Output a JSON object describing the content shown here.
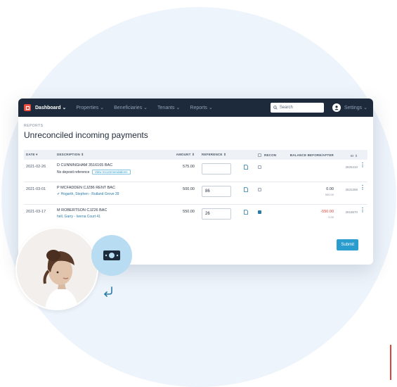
{
  "nav": {
    "items": [
      {
        "label": "Dashboard",
        "active": true
      },
      {
        "label": "Properties",
        "active": false
      },
      {
        "label": "Beneficiaries",
        "active": false
      },
      {
        "label": "Tenants",
        "active": false
      },
      {
        "label": "Reports",
        "active": false
      }
    ],
    "search_placeholder": "Search",
    "settings_label": "Settings",
    "dropdown_glyph": "⌄"
  },
  "page": {
    "breadcrumb": "REPORTS",
    "title": "Unreconciled incoming payments",
    "submit_label": "Submit"
  },
  "table": {
    "headers": {
      "date": "DATE",
      "description": "DESCRIPTION",
      "amount": "AMOUNT",
      "reference": "REFERENCE",
      "recon": "RECON",
      "balance": "BALANCE BEFORE/AFTER",
      "id": "ID"
    },
    "rows": [
      {
        "date": "2021-02-26",
        "description": "D CUNNINGHAM 3516165 BAC",
        "detail": "No deposit reference",
        "action": "View recommendations",
        "matched": "",
        "amount": "575.00",
        "reference": "",
        "recon_checked": false,
        "balance": "",
        "balance_after": "",
        "id": "2625410"
      },
      {
        "date": "2021-03-01",
        "description": "P MCFADDEN CJZ86 RENT BAC",
        "detail": "",
        "action": "",
        "matched": "Hogarth, Stephen - Rutland Grove 39",
        "amount": "500.00",
        "reference": "86",
        "recon_checked": false,
        "balance": "0.00",
        "balance_after": "500.00",
        "id": "2631269"
      },
      {
        "date": "2021-03-17",
        "description": "M ROBERTSON CJZ26 BAC",
        "detail": "",
        "action": "",
        "matched": "hell, Garry - Iverna Court 41",
        "amount": "550.00",
        "reference": "26",
        "recon_checked": true,
        "balance": "-550.00",
        "balance_after": "0.00",
        "id": "2618670"
      }
    ]
  },
  "colors": {
    "nav_bg": "#1c2a3c",
    "accent": "#2a9ccd",
    "brand": "#e84b3c",
    "negative": "#d8453b"
  },
  "icons": [
    "logo-icon",
    "search-icon",
    "user-icon",
    "document-icon",
    "kebab-menu-icon",
    "money-icon",
    "return-arrow-icon"
  ]
}
